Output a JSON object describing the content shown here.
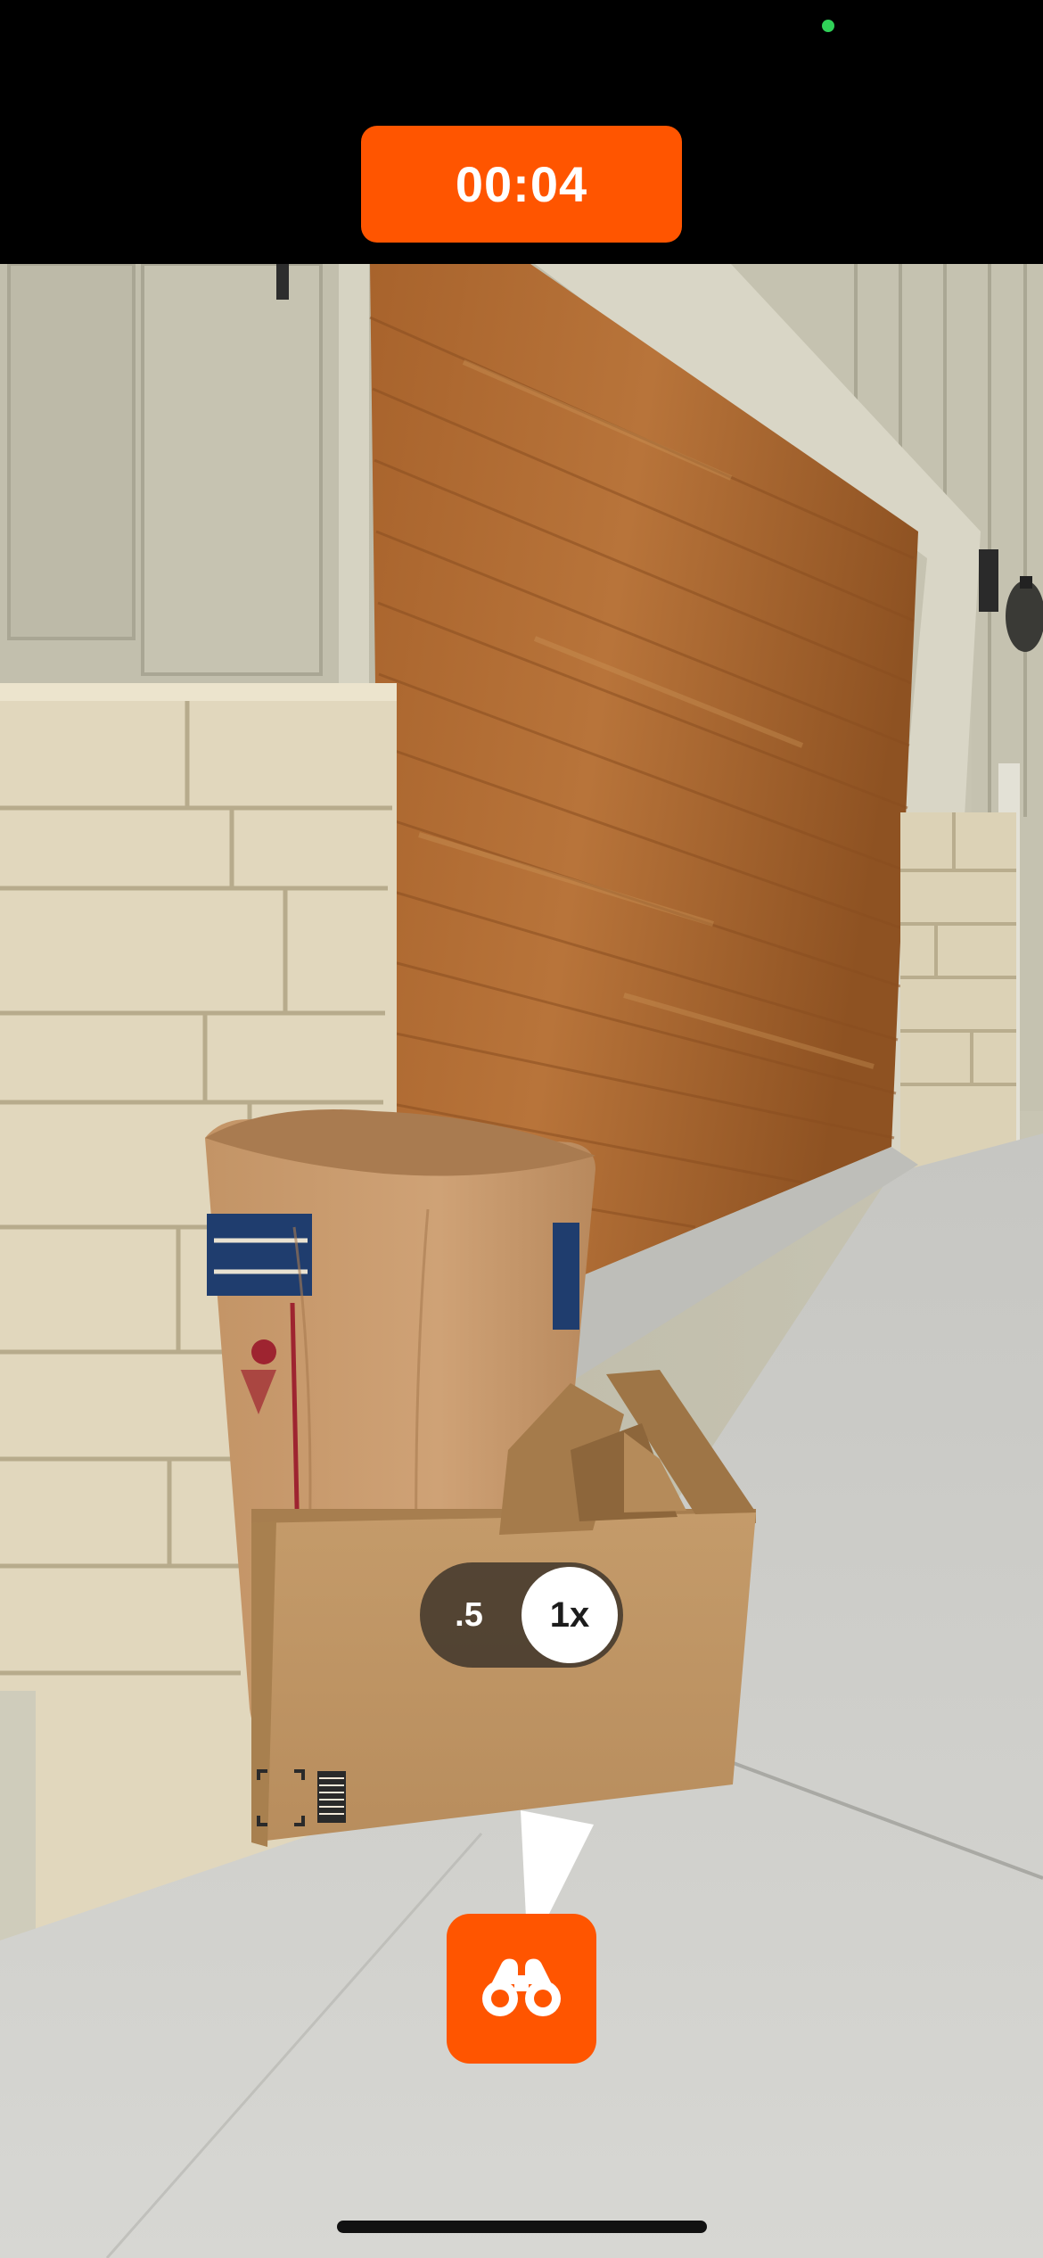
{
  "status_bar": {
    "privacy_indicator_color": "#30d158"
  },
  "timer": {
    "label": "00:04",
    "color": "#ff5500"
  },
  "zoom": {
    "options": [
      ".5",
      "1x"
    ],
    "selected": "1x"
  },
  "find_button": {
    "icon": "binoculars-icon",
    "color": "#ff5500"
  },
  "accent_color": "#ff5500"
}
